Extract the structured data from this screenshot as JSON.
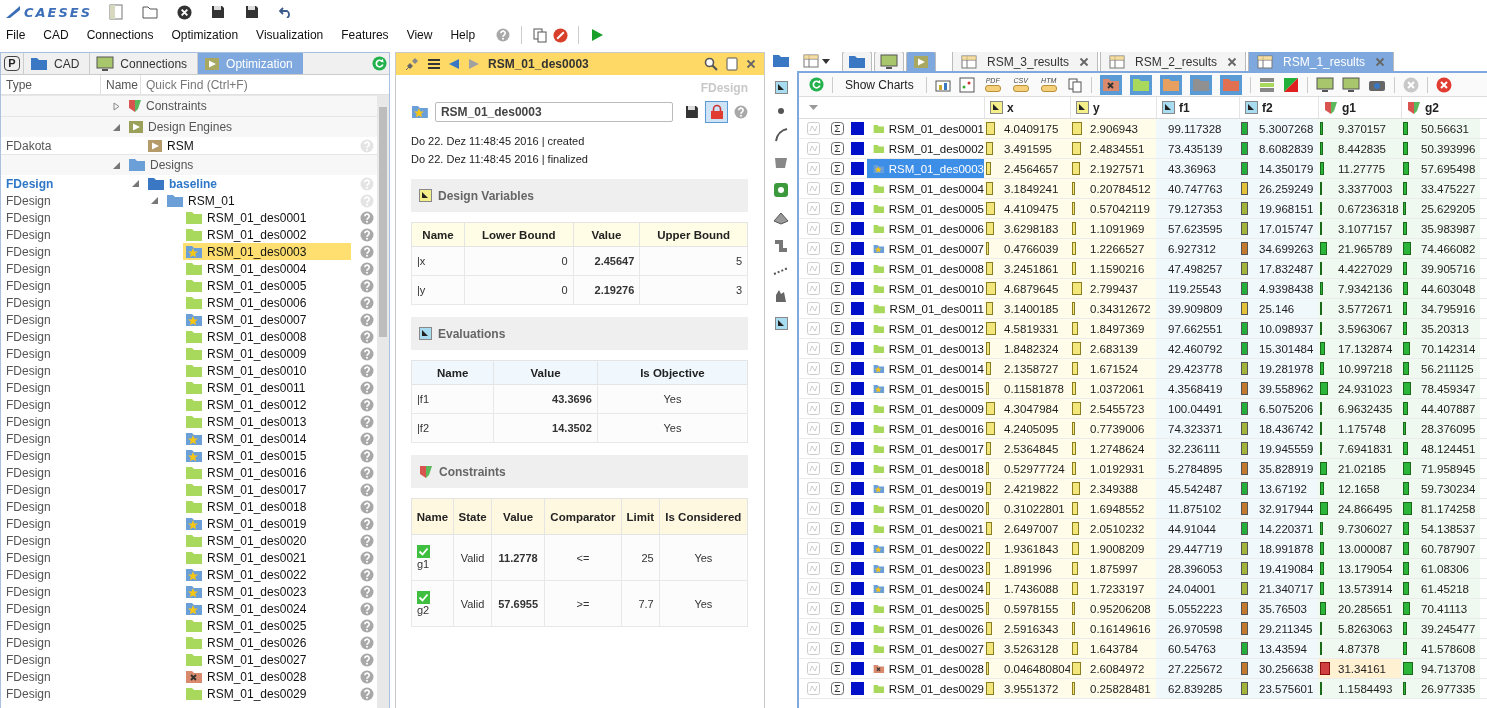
{
  "logo": "CAESES",
  "menu": [
    "File",
    "CAD",
    "Connections",
    "Optimization",
    "Visualization",
    "Features",
    "View",
    "Help"
  ],
  "left_panel": {
    "project_button": "P",
    "tabs": [
      {
        "label": "CAD",
        "kind": "cad",
        "selected": false
      },
      {
        "label": "Connections",
        "kind": "connections",
        "selected": false
      },
      {
        "label": "Optimization",
        "kind": "optimization",
        "selected": true
      }
    ],
    "columns": [
      "Type",
      "Name"
    ],
    "search": {
      "placeholder": "Quick Find (Ctrl+F)"
    },
    "tree": [
      {
        "label": "Constraints",
        "kind": "constraints",
        "expanded": false
      },
      {
        "label": "Design Engines",
        "kind": "engines",
        "expanded": true,
        "children": [
          {
            "label": "RSM",
            "type": "FDakota",
            "kind": "engine"
          }
        ]
      },
      {
        "label": "Designs",
        "kind": "designs",
        "expanded": true,
        "children": [
          {
            "label": "baseline",
            "type": "FDesign",
            "kind": "folder",
            "active": true,
            "expanded": true,
            "children": [
              {
                "label": "RSM_01",
                "type": "FDesign",
                "kind": "folder",
                "active": false,
                "expanded": true,
                "children": [
                  {
                    "label": "RSM_01_des0001",
                    "type": "FDesign",
                    "kind": "normal",
                    "selected": false
                  },
                  {
                    "label": "RSM_01_des0002",
                    "type": "FDesign",
                    "kind": "normal",
                    "selected": false
                  },
                  {
                    "label": "RSM_01_des0003",
                    "type": "FDesign",
                    "kind": "pareto",
                    "selected": true
                  },
                  {
                    "label": "RSM_01_des0004",
                    "type": "FDesign",
                    "kind": "normal",
                    "selected": false
                  },
                  {
                    "label": "RSM_01_des0005",
                    "type": "FDesign",
                    "kind": "normal",
                    "selected": false
                  },
                  {
                    "label": "RSM_01_des0006",
                    "type": "FDesign",
                    "kind": "normal",
                    "selected": false
                  },
                  {
                    "label": "RSM_01_des0007",
                    "type": "FDesign",
                    "kind": "pareto",
                    "selected": false
                  },
                  {
                    "label": "RSM_01_des0008",
                    "type": "FDesign",
                    "kind": "normal",
                    "selected": false
                  },
                  {
                    "label": "RSM_01_des0009",
                    "type": "FDesign",
                    "kind": "normal",
                    "selected": false
                  },
                  {
                    "label": "RSM_01_des0010",
                    "type": "FDesign",
                    "kind": "normal",
                    "selected": false
                  },
                  {
                    "label": "RSM_01_des0011",
                    "type": "FDesign",
                    "kind": "normal",
                    "selected": false
                  },
                  {
                    "label": "RSM_01_des0012",
                    "type": "FDesign",
                    "kind": "normal",
                    "selected": false
                  },
                  {
                    "label": "RSM_01_des0013",
                    "type": "FDesign",
                    "kind": "normal",
                    "selected": false
                  },
                  {
                    "label": "RSM_01_des0014",
                    "type": "FDesign",
                    "kind": "pareto",
                    "selected": false
                  },
                  {
                    "label": "RSM_01_des0015",
                    "type": "FDesign",
                    "kind": "pareto",
                    "selected": false
                  },
                  {
                    "label": "RSM_01_des0016",
                    "type": "FDesign",
                    "kind": "normal",
                    "selected": false
                  },
                  {
                    "label": "RSM_01_des0017",
                    "type": "FDesign",
                    "kind": "normal",
                    "selected": false
                  },
                  {
                    "label": "RSM_01_des0018",
                    "type": "FDesign",
                    "kind": "normal",
                    "selected": false
                  },
                  {
                    "label": "RSM_01_des0019",
                    "type": "FDesign",
                    "kind": "pareto",
                    "selected": false
                  },
                  {
                    "label": "RSM_01_des0020",
                    "type": "FDesign",
                    "kind": "normal",
                    "selected": false
                  },
                  {
                    "label": "RSM_01_des0021",
                    "type": "FDesign",
                    "kind": "normal",
                    "selected": false
                  },
                  {
                    "label": "RSM_01_des0022",
                    "type": "FDesign",
                    "kind": "pareto",
                    "selected": false
                  },
                  {
                    "label": "RSM_01_des0023",
                    "type": "FDesign",
                    "kind": "pareto",
                    "selected": false
                  },
                  {
                    "label": "RSM_01_des0024",
                    "type": "FDesign",
                    "kind": "pareto",
                    "selected": false
                  },
                  {
                    "label": "RSM_01_des0025",
                    "type": "FDesign",
                    "kind": "normal",
                    "selected": false
                  },
                  {
                    "label": "RSM_01_des0026",
                    "type": "FDesign",
                    "kind": "normal",
                    "selected": false
                  },
                  {
                    "label": "RSM_01_des0027",
                    "type": "FDesign",
                    "kind": "normal",
                    "selected": false
                  },
                  {
                    "label": "RSM_01_des0028",
                    "type": "FDesign",
                    "kind": "failed",
                    "selected": false
                  },
                  {
                    "label": "RSM_01_des0029",
                    "type": "FDesign",
                    "kind": "normal",
                    "selected": false
                  }
                ]
              }
            ]
          }
        ]
      }
    ]
  },
  "detail": {
    "title": "RSM_01_des0003",
    "type": "FDesign",
    "name": "RSM_01_des0003",
    "kind": "pareto",
    "locked": true,
    "history": [
      "Do 22. Dez 11:48:45 2016 | created",
      "Do 22. Dez 11:48:45 2016 | finalized"
    ],
    "variables": {
      "heading": "Design Variables",
      "columns": [
        "Name",
        "Lower Bound",
        "Value",
        "Upper Bound"
      ],
      "rows": [
        [
          "|x",
          "0",
          "2.45647",
          "5"
        ],
        [
          "|y",
          "0",
          "2.19276",
          "3"
        ]
      ]
    },
    "evaluations": {
      "heading": "Evaluations",
      "columns": [
        "Name",
        "Value",
        "Is Objective"
      ],
      "rows": [
        [
          "|f1",
          "43.3696",
          "Yes"
        ],
        [
          "|f2",
          "14.3502",
          "Yes"
        ]
      ]
    },
    "constraints": {
      "heading": "Constraints",
      "columns": [
        "Name",
        "State",
        "Value",
        "Comparator",
        "Limit",
        "Is Considered"
      ],
      "rows": [
        {
          "name": "g1",
          "valid": true,
          "state": "Valid",
          "value": "11.2778",
          "comparator": "<=",
          "limit": "25",
          "considered": "Yes",
          "upper_bound": true
        },
        {
          "name": "g2",
          "valid": true,
          "state": "Valid",
          "value": "57.6955",
          "comparator": ">=",
          "limit": "7.7",
          "considered": "Yes",
          "upper_bound": false
        }
      ]
    }
  },
  "results": {
    "view_tabs": [
      {
        "kind": "folder",
        "selected": false
      },
      {
        "kind": "monitor",
        "selected": false
      },
      {
        "kind": "play",
        "selected": true
      }
    ],
    "tabs": [
      {
        "label": "RSM_3_results",
        "selected": false
      },
      {
        "label": "RSM_2_results",
        "selected": false
      },
      {
        "label": "RSM_1_results",
        "selected": true
      }
    ],
    "show_charts": "Show Charts",
    "export_labels": [
      "PDF",
      "CSV",
      "HTM"
    ],
    "filters": [
      {
        "kind": "failed",
        "on": true
      },
      {
        "kind": "normal",
        "on": true
      },
      {
        "kind": "pending",
        "on": true
      },
      {
        "kind": "disabled",
        "on": true
      },
      {
        "kind": "error",
        "on": true
      }
    ],
    "columns": [
      {
        "label": "x",
        "kind": "variable",
        "bar": true
      },
      {
        "label": "y",
        "kind": "variable",
        "bar": true
      },
      {
        "label": "f1",
        "kind": "evaluation",
        "bar": false
      },
      {
        "label": "f2",
        "kind": "evaluation",
        "bar": true
      },
      {
        "label": "g1",
        "kind": "constraint",
        "bar": true
      },
      {
        "label": "g2",
        "kind": "constraint",
        "bar": true
      }
    ],
    "rows": [
      {
        "name": "RSM_01_des0001",
        "kind": "normal",
        "selected": false,
        "values": [
          "4.0409175",
          "2.906943",
          "99.117328",
          "5.3007268",
          "9.370157",
          "50.56631"
        ]
      },
      {
        "name": "RSM_01_des0002",
        "kind": "normal",
        "selected": false,
        "values": [
          "3.491595",
          "2.4834551",
          "73.435139",
          "8.6082839",
          "8.442835",
          "50.393996"
        ]
      },
      {
        "name": "RSM_01_des0003",
        "kind": "pareto",
        "selected": true,
        "values": [
          "2.4564657",
          "2.1927571",
          "43.36963",
          "14.350179",
          "11.27775",
          "57.695498"
        ]
      },
      {
        "name": "RSM_01_des0004",
        "kind": "normal",
        "selected": false,
        "values": [
          "3.1849241",
          "0.20784512",
          "40.747763",
          "26.259249",
          "3.3377003",
          "33.475227"
        ]
      },
      {
        "name": "RSM_01_des0005",
        "kind": "normal",
        "selected": false,
        "values": [
          "4.4109475",
          "0.57042119",
          "79.127353",
          "19.968151",
          "0.67236318",
          "25.629205"
        ]
      },
      {
        "name": "RSM_01_des0006",
        "kind": "normal",
        "selected": false,
        "values": [
          "3.6298183",
          "1.1091969",
          "57.623595",
          "17.015747",
          "3.1077157",
          "35.983987"
        ]
      },
      {
        "name": "RSM_01_des0007",
        "kind": "pareto",
        "selected": false,
        "values": [
          "0.4766039",
          "1.2266527",
          "6.927312",
          "34.699263",
          "21.965789",
          "74.466082"
        ]
      },
      {
        "name": "RSM_01_des0008",
        "kind": "normal",
        "selected": false,
        "values": [
          "3.2451861",
          "1.1590216",
          "47.498257",
          "17.832487",
          "4.4227029",
          "39.905716"
        ]
      },
      {
        "name": "RSM_01_des0010",
        "kind": "normal",
        "selected": false,
        "values": [
          "4.6879645",
          "2.799437",
          "119.25543",
          "4.9398438",
          "7.9342136",
          "44.603048"
        ]
      },
      {
        "name": "RSM_01_des0011",
        "kind": "normal",
        "selected": false,
        "values": [
          "3.1400185",
          "0.34312672",
          "39.909809",
          "25.146",
          "3.5772671",
          "34.795916"
        ]
      },
      {
        "name": "RSM_01_des0012",
        "kind": "normal",
        "selected": false,
        "values": [
          "4.5819331",
          "1.8497369",
          "97.662551",
          "10.098937",
          "3.5963067",
          "35.20313"
        ]
      },
      {
        "name": "RSM_01_des0013",
        "kind": "normal",
        "selected": false,
        "values": [
          "1.8482324",
          "2.683139",
          "42.460792",
          "15.301484",
          "17.132874",
          "70.142314"
        ]
      },
      {
        "name": "RSM_01_des0014",
        "kind": "pareto",
        "selected": false,
        "values": [
          "2.1358727",
          "1.671524",
          "29.423778",
          "19.281978",
          "10.997218",
          "56.211125"
        ]
      },
      {
        "name": "RSM_01_des0015",
        "kind": "pareto",
        "selected": false,
        "values": [
          "0.11581878",
          "1.0372061",
          "4.3568419",
          "39.558962",
          "24.931023",
          "78.459347"
        ]
      },
      {
        "name": "RSM_01_des0009",
        "kind": "normal",
        "selected": false,
        "values": [
          "4.3047984",
          "2.5455723",
          "100.04491",
          "6.5075206",
          "6.9632435",
          "44.407887"
        ]
      },
      {
        "name": "RSM_01_des0016",
        "kind": "normal",
        "selected": false,
        "values": [
          "4.2405095",
          "0.7739006",
          "74.323371",
          "18.436742",
          "1.175748",
          "28.376095"
        ]
      },
      {
        "name": "RSM_01_des0017",
        "kind": "normal",
        "selected": false,
        "values": [
          "2.5364845",
          "1.2748624",
          "32.236111",
          "19.945559",
          "7.6941831",
          "48.124451"
        ]
      },
      {
        "name": "RSM_01_des0018",
        "kind": "normal",
        "selected": false,
        "values": [
          "0.52977724",
          "1.0192931",
          "5.2784895",
          "35.828919",
          "21.02185",
          "71.958945"
        ]
      },
      {
        "name": "RSM_01_des0019",
        "kind": "pareto",
        "selected": false,
        "values": [
          "2.4219822",
          "2.349388",
          "45.542487",
          "13.67192",
          "12.1658",
          "59.730234"
        ]
      },
      {
        "name": "RSM_01_des0020",
        "kind": "normal",
        "selected": false,
        "values": [
          "0.31022801",
          "1.6948552",
          "11.875102",
          "32.917944",
          "24.866495",
          "81.174258"
        ]
      },
      {
        "name": "RSM_01_des0021",
        "kind": "normal",
        "selected": false,
        "values": [
          "2.6497007",
          "2.0510232",
          "44.91044",
          "14.220371",
          "9.7306027",
          "54.138537"
        ]
      },
      {
        "name": "RSM_01_des0022",
        "kind": "pareto",
        "selected": false,
        "values": [
          "1.9361843",
          "1.9008209",
          "29.447719",
          "18.991878",
          "13.000087",
          "60.787907"
        ]
      },
      {
        "name": "RSM_01_des0023",
        "kind": "pareto",
        "selected": false,
        "values": [
          "1.891996",
          "1.875997",
          "28.396053",
          "19.419084",
          "13.179054",
          "61.08306"
        ]
      },
      {
        "name": "RSM_01_des0024",
        "kind": "pareto",
        "selected": false,
        "values": [
          "1.7436088",
          "1.7233197",
          "24.04001",
          "21.340717",
          "13.573914",
          "61.45218"
        ]
      },
      {
        "name": "RSM_01_des0025",
        "kind": "normal",
        "selected": false,
        "values": [
          "0.5978155",
          "0.95206208",
          "5.0552223",
          "35.76503",
          "20.285651",
          "70.41113"
        ]
      },
      {
        "name": "RSM_01_des0026",
        "kind": "normal",
        "selected": false,
        "values": [
          "2.5916343",
          "0.16149616",
          "26.970598",
          "29.211345",
          "5.8263063",
          "39.245477"
        ]
      },
      {
        "name": "RSM_01_des0027",
        "kind": "normal",
        "selected": false,
        "values": [
          "3.5263128",
          "1.643784",
          "60.54763",
          "13.43594",
          "4.87378",
          "41.578608"
        ]
      },
      {
        "name": "RSM_01_des0028",
        "kind": "failed",
        "selected": false,
        "values": [
          "0.046480804",
          "2.6084972",
          "27.225672",
          "30.256638",
          "31.34161",
          "94.713708"
        ]
      },
      {
        "name": "RSM_01_des0029",
        "kind": "normal",
        "selected": false,
        "values": [
          "3.9551372",
          "0.25828481",
          "62.839285",
          "23.575601",
          "1.1584493",
          "26.977335"
        ]
      }
    ]
  }
}
